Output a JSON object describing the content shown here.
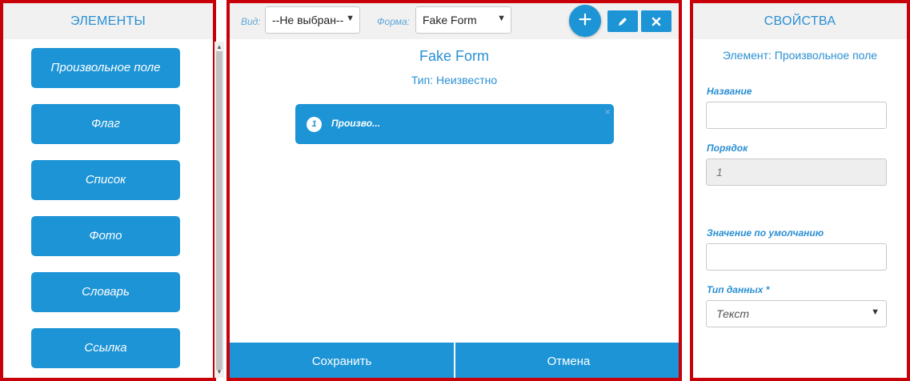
{
  "colors": {
    "accent": "#1c94d6",
    "frame": "#c8000a",
    "header_bg": "#f1f1f1",
    "label": "#2a8fd3"
  },
  "elements_panel": {
    "title": "ЭЛЕМЕНТЫ",
    "items": [
      "Произвольное поле",
      "Флаг",
      "Список",
      "Фото",
      "Словарь",
      "Ссылка"
    ]
  },
  "toolbar": {
    "view_label": "Вид:",
    "view_value": "--Не выбран--",
    "form_label": "Форма:",
    "form_value": "Fake Form",
    "add_icon": "plus-icon",
    "edit_icon": "pencil-icon",
    "delete_icon": "close-icon"
  },
  "form": {
    "title": "Fake Form",
    "type_text": "Тип: Неизвестно",
    "items": [
      {
        "number": "1",
        "label": "Произво...",
        "remove": "×"
      }
    ]
  },
  "footer": {
    "save_label": "Сохранить",
    "cancel_label": "Отмена"
  },
  "properties_panel": {
    "title": "СВОЙСТВА",
    "element_caption": "Элемент: Произвольное поле",
    "name_label": "Название",
    "name_value": "",
    "order_label": "Порядок",
    "order_value": "1",
    "default_label": "Значение по умолчанию",
    "default_value": "",
    "datatype_label": "Тип данных *",
    "datatype_value": "Текст"
  }
}
